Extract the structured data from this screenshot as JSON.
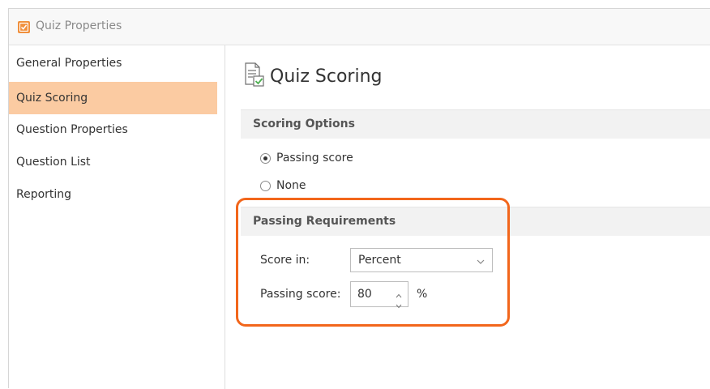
{
  "window": {
    "title": "Quiz Properties",
    "app_icon": "quiz-app-icon"
  },
  "sidebar": {
    "items": [
      {
        "label": "General Properties",
        "selected": false
      },
      {
        "label": "Quiz Scoring",
        "selected": true
      },
      {
        "label": "Question Properties",
        "selected": false
      },
      {
        "label": "Question List",
        "selected": false
      },
      {
        "label": "Reporting",
        "selected": false
      }
    ]
  },
  "main": {
    "title": "Quiz Scoring",
    "header_icon": "quiz-scoring-icon",
    "scoring_options": {
      "heading": "Scoring Options",
      "options": [
        {
          "label": "Passing score",
          "checked": true
        },
        {
          "label": "None",
          "checked": false
        }
      ]
    },
    "passing_requirements": {
      "heading": "Passing Requirements",
      "score_in_label": "Score in:",
      "score_in_value": "Percent",
      "passing_score_label": "Passing score:",
      "passing_score_value": "80",
      "unit": "%"
    }
  },
  "colors": {
    "accent": "#f0903d",
    "selected_nav_bg": "#fbcba2",
    "highlight_border": "#f2661b",
    "section_bg": "#f2f2f2"
  }
}
